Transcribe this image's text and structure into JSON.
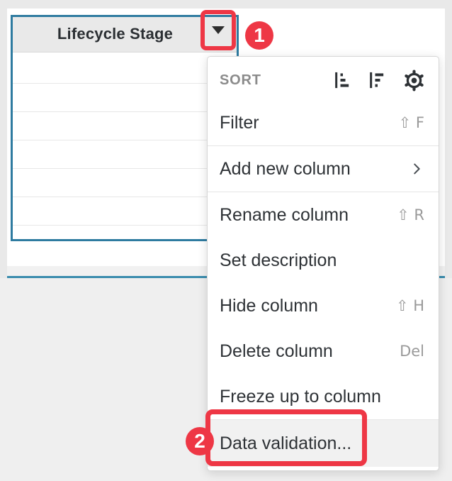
{
  "grid": {
    "header": {
      "title": "Lifecycle Stage"
    },
    "row_count": 7
  },
  "menu": {
    "sort_label": "SORT",
    "sort_icons": [
      "sort-ascending-icon",
      "sort-descending-icon",
      "sort-settings-gear-icon"
    ],
    "items": [
      {
        "label": "Filter",
        "shortcut": "⇧ F"
      },
      {
        "label": "Add new column",
        "shortcut": "",
        "has_submenu": true
      },
      {
        "label": "Rename column",
        "shortcut": "⇧ R"
      },
      {
        "label": "Set description",
        "shortcut": ""
      },
      {
        "label": "Hide column",
        "shortcut": "⇧ H"
      },
      {
        "label": "Delete column",
        "shortcut": "Del"
      },
      {
        "label": "Freeze up to column",
        "shortcut": ""
      },
      {
        "label": "Data validation...",
        "shortcut": "",
        "highlighted": true
      }
    ]
  },
  "annotations": {
    "badge1": "1",
    "badge2": "2",
    "color": "#ee3745"
  },
  "colors": {
    "selection_teal": "#2e7ba0",
    "grid_bottom_teal": "#3a8cad",
    "header_fill": "#e9e9e9"
  }
}
